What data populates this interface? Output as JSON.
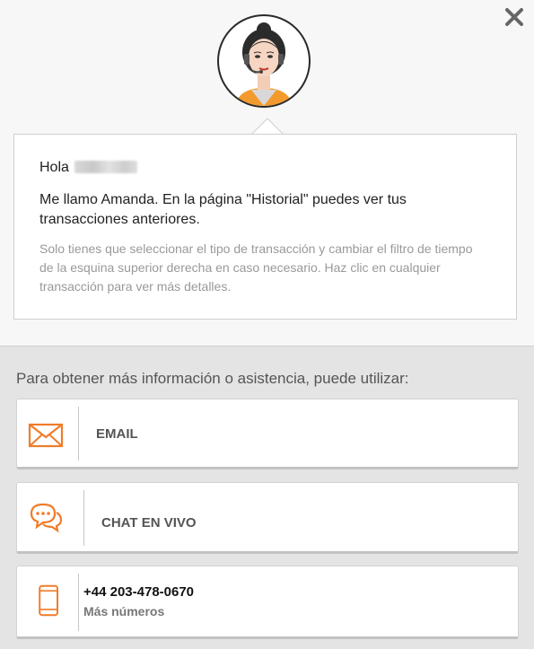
{
  "header": {
    "close_icon": "close-icon",
    "avatar_icon": "agent-avatar-icon"
  },
  "message": {
    "greeting": "Hola",
    "intro": "Me llamo Amanda. En la página \"Historial\" puedes ver tus transacciones anteriores.",
    "tip": "Solo tienes que seleccionar el tipo de transacción y cambiar el filtro de tiempo de la esquina superior derecha en caso necesario. Haz clic en cualquier transacción para ver más detalles."
  },
  "help": {
    "title": "Para obtener más información o asistencia, puede utilizar:",
    "email_label": "EMAIL",
    "chat_label": "CHAT EN VIVO",
    "phone_number": "+44 203-478-0670",
    "phone_more": "Más números"
  },
  "colors": {
    "accent": "#f07c2a",
    "panel_bg": "#f7f7f7",
    "footer_bg": "#e4e4e4"
  }
}
